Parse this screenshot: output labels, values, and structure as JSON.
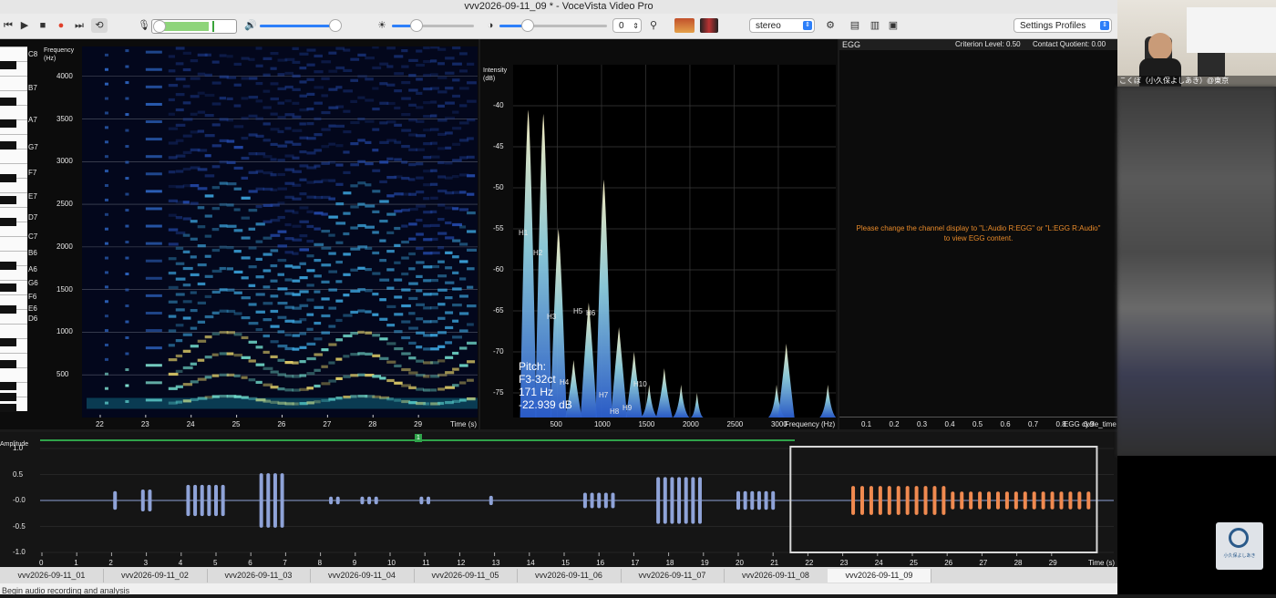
{
  "window": {
    "title": "vvv2026-09-11_09 * - VoceVista Video Pro"
  },
  "toolbar": {
    "pitch_value": "0",
    "channel_select": "stereo",
    "settings_profiles": "Settings Profiles"
  },
  "spectrogram": {
    "y_title": "Frequency\n(Hz)",
    "y_ticks": [
      "4000",
      "3500",
      "3000",
      "2500",
      "2000",
      "1500",
      "1000",
      "500"
    ],
    "x_ticks": [
      "22",
      "23",
      "24",
      "25",
      "26",
      "27",
      "28",
      "29"
    ],
    "x_unit": "Time (s)",
    "notes": [
      "C8",
      "B7",
      "A7",
      "G7",
      "F7",
      "E7",
      "D7",
      "C7",
      "B6",
      "A6",
      "G6",
      "F6",
      "E6",
      "D6"
    ]
  },
  "spectrum": {
    "y_title": "Intensity\n(dB)",
    "y_ticks": [
      "-40",
      "-45",
      "-50",
      "-55",
      "-60",
      "-65",
      "-70",
      "-75"
    ],
    "x_ticks": [
      "500",
      "1000",
      "1500",
      "2000",
      "2500",
      "3000"
    ],
    "x_unit": "Frequency (Hz)",
    "harmonics": [
      "H1",
      "H2",
      "H3",
      "H4",
      "H5",
      "H6",
      "H7",
      "H8",
      "H9",
      "H10"
    ],
    "pitch_box": {
      "label": "Pitch:",
      "note": "F3-32ct",
      "hz": "171 Hz",
      "db": "-22.939 dB"
    }
  },
  "egg": {
    "title": "EGG",
    "criterion": "Criterion Level: 0.50",
    "contact": "Contact Quotient: 0.00",
    "message_line1": "Please change the channel display to \"L:Audio R:EGG\" or \"L:EGG R:Audio\"",
    "message_line2": "to view EGG content.",
    "x_ticks": [
      "0.1",
      "0.2",
      "0.3",
      "0.4",
      "0.5",
      "0.6",
      "0.7",
      "0.8",
      "0.9"
    ],
    "x_unit": "EGG cycle_time"
  },
  "waveform": {
    "y_title": "Amplitude",
    "y_ticks": [
      "1.0",
      "0.5",
      "-0.0",
      "-0.5",
      "-1.0"
    ],
    "x_ticks": [
      "0",
      "1",
      "2",
      "3",
      "4",
      "5",
      "6",
      "7",
      "8",
      "9",
      "10",
      "11",
      "12",
      "13",
      "14",
      "15",
      "16",
      "17",
      "18",
      "19",
      "20",
      "21",
      "22",
      "23",
      "24",
      "25",
      "26",
      "27",
      "28",
      "29"
    ],
    "x_unit": "Time (s)",
    "marker": "1"
  },
  "file_tabs": [
    "vvv2026-09-11_01",
    "vvv2026-09-11_02",
    "vvv2026-09-11_03",
    "vvv2026-09-11_04",
    "vvv2026-09-11_05",
    "vvv2026-09-11_06",
    "vvv2026-09-11_07",
    "vvv2026-09-11_08",
    "vvv2026-09-11_09"
  ],
  "status": "Begin audio recording and analysis",
  "webcam": {
    "name": "こくぼ（小久保よしあき）@東京",
    "logo_text": "小久保よしあき"
  },
  "colors": {
    "accent": "#2d7ff9",
    "egg_message": "#e88a2a",
    "waveform": "#8fa3d8",
    "waveform_selected": "#f08a50"
  }
}
